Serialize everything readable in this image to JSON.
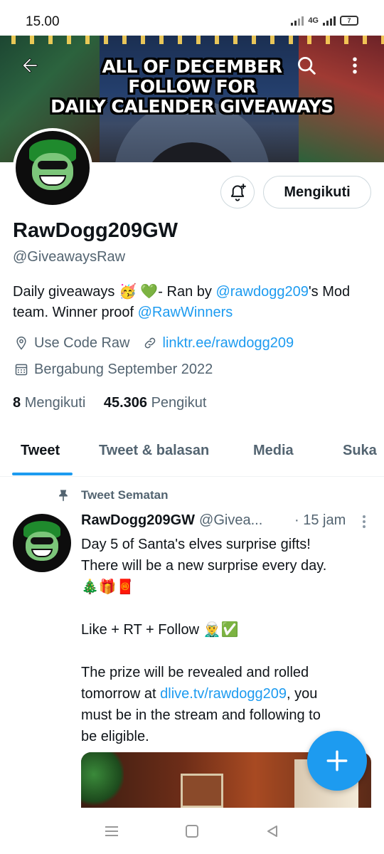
{
  "status_bar": {
    "time": "15.00",
    "network": "4G",
    "battery": "7"
  },
  "banner": {
    "line1": "ALL OF DECEMBER",
    "line2": "FOLLOW FOR",
    "line3": "DAILY CALENDER GIVEAWAYS"
  },
  "profile": {
    "name": "RawDogg209GW",
    "handle": "@GiveawaysRaw",
    "follow_button": "Mengikuti",
    "bio": {
      "part1": "Daily giveaways 🥳 💚- Ran by ",
      "mention1": "@rawdogg209",
      "part2": "'s Mod team.  Winner proof ",
      "mention2": "@RawWinners"
    },
    "location": "Use Code Raw",
    "website": "linktr.ee/rawdogg209",
    "joined": "Bergabung September 2022",
    "following_count": "8",
    "following_label": "Mengikuti",
    "followers_count": "45.306",
    "followers_label": "Pengikut"
  },
  "tabs": [
    "Tweet",
    "Tweet & balasan",
    "Media",
    "Suka"
  ],
  "active_tab": "Tweet",
  "tweet": {
    "pinned_label": "Tweet Sematan",
    "author_name": "RawDogg209GW",
    "author_handle": "@Givea...",
    "time": "· 15 jam",
    "line1": "Day 5 of Santa's elves surprise gifts!",
    "line2": "There will be a new surprise every day.",
    "line3": "🎄🎁🧧",
    "line4": "Like + RT + Follow 🧝‍♂️✅",
    "line5a": "The prize will be revealed and rolled",
    "line5b": "tomorrow at ",
    "line5link": "dlive.tv/rawdogg209",
    "line5c": ", you",
    "line6": "must be in the stream and following to",
    "line7": "be eligible."
  },
  "colors": {
    "accent": "#1d9bf0",
    "text_primary": "#0f1419",
    "text_secondary": "#536471"
  },
  "icons": {
    "back": "arrow-left-icon",
    "search": "search-icon",
    "more": "more-vertical-icon",
    "bell": "bell-plus-icon",
    "location": "location-pin-icon",
    "link": "link-icon",
    "calendar": "calendar-icon",
    "pin": "pin-icon",
    "compose": "plus-icon"
  }
}
